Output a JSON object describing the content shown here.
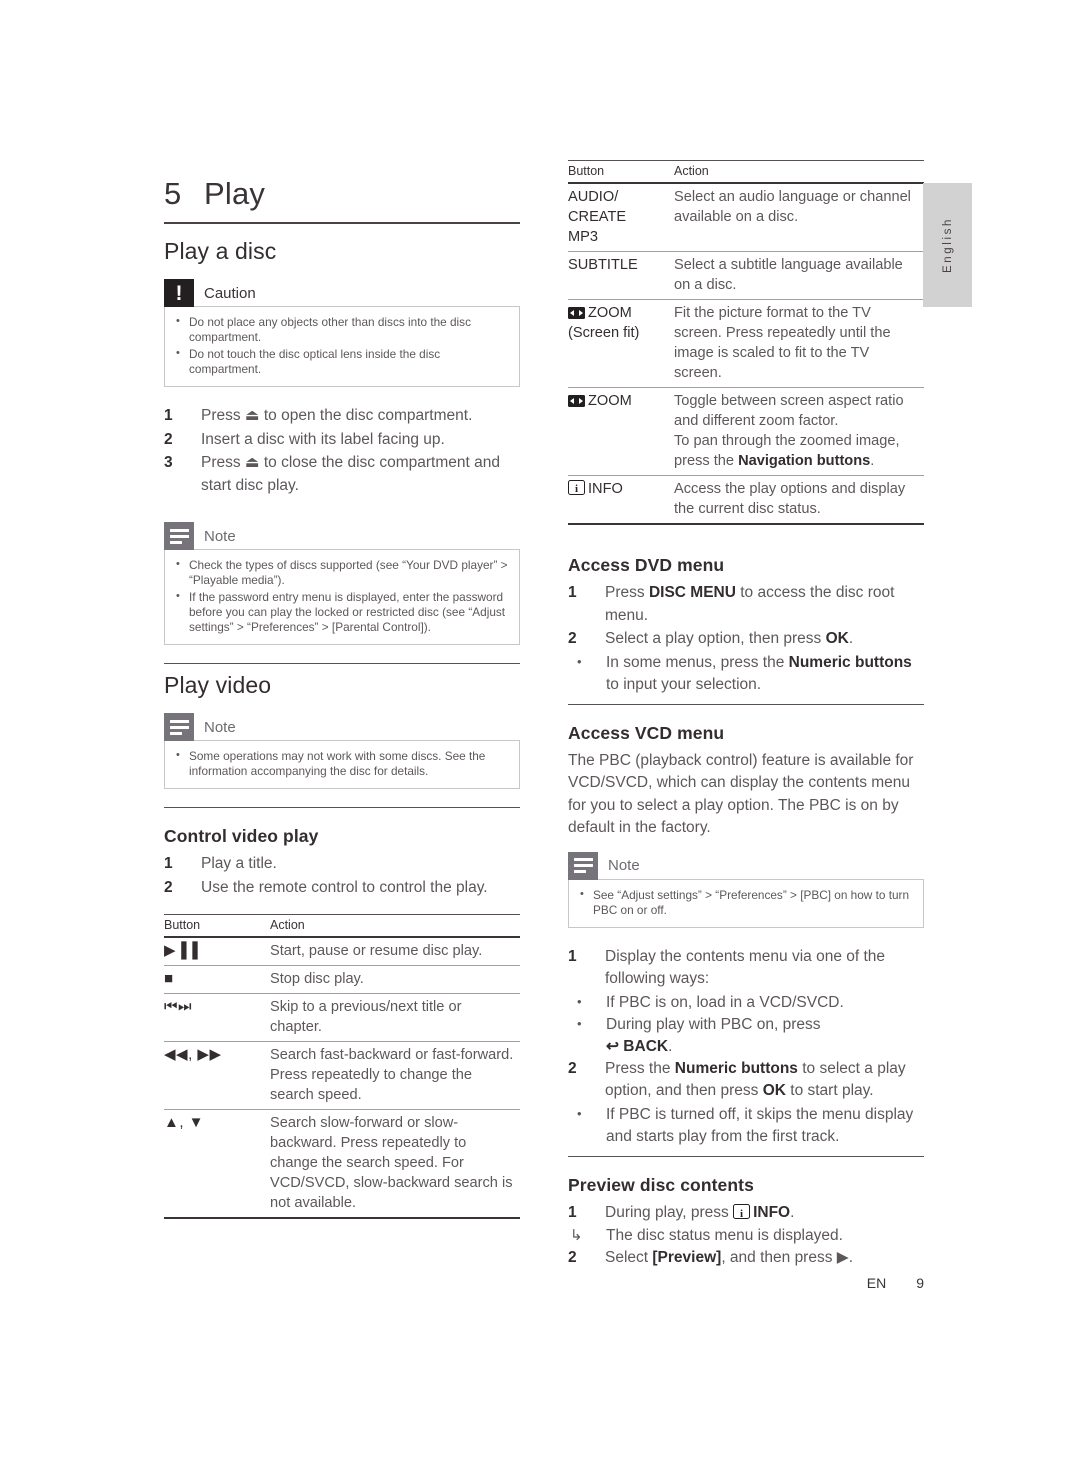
{
  "document": {
    "chapter_number": "5",
    "chapter_title": "Play",
    "language_tab": "English",
    "footer_locale": "EN",
    "footer_page": "9"
  },
  "left_column": {
    "section_play_a_disc": {
      "heading": "Play a disc",
      "caution": {
        "label": "Caution",
        "icon": "caution-icon",
        "items": [
          "Do not place any objects other than discs into the disc compartment.",
          "Do not touch the disc optical lens inside the disc compartment."
        ]
      },
      "steps": [
        {
          "num": "1",
          "text": "Press ⏏ to open the disc compartment."
        },
        {
          "num": "2",
          "text": "Insert a disc with its label facing up."
        },
        {
          "num": "3",
          "text": "Press ⏏ to close the disc compartment and start disc play."
        }
      ],
      "note": {
        "label": "Note",
        "icon": "note-icon",
        "items": [
          "Check the types of discs supported (see “Your DVD player” > “Playable media”).",
          "If the password entry menu is displayed, enter the password before you can play the locked or restricted disc (see “Adjust settings” > “Preferences” > [Parental Control])."
        ]
      }
    },
    "section_play_video": {
      "heading": "Play video",
      "note": {
        "label": "Note",
        "icon": "note-icon",
        "items": [
          "Some operations may not work with some discs. See the information accompanying the disc for details."
        ]
      },
      "subsection_control_video_play": {
        "heading": "Control video play",
        "steps": [
          {
            "num": "1",
            "text": "Play a title."
          },
          {
            "num": "2",
            "text": "Use the remote control to control the play."
          }
        ],
        "table": {
          "headers": [
            "Button",
            "Action"
          ],
          "rows": [
            {
              "button": "▶▐▐",
              "button_icon": "play-pause-icon",
              "action": "Start, pause or resume disc play."
            },
            {
              "button": "■",
              "button_icon": "stop-icon",
              "action": "Stop disc play."
            },
            {
              "button": "⏮⏭",
              "button_icon": "skip-previous-next-icon",
              "action": "Skip to a previous/next title or chapter."
            },
            {
              "button": "◀◀, ▶▶",
              "button_icon": "rewind-fastforward-icon",
              "action": "Search fast-backward or fast-forward. Press repeatedly to change the search speed."
            },
            {
              "button": "▲, ▼",
              "button_icon": "up-down-icon",
              "action": "Search slow-forward or slow-backward. Press repeatedly to change the search speed. For VCD/SVCD, slow-backward search is not available."
            }
          ]
        }
      }
    }
  },
  "right_column": {
    "table_continued": {
      "headers": [
        "Button",
        "Action"
      ],
      "rows": [
        {
          "button": "AUDIO/ CREATE MP3",
          "button_lines": [
            "AUDIO/",
            "CREATE",
            "MP3"
          ],
          "action": "Select an audio language or channel available on a disc."
        },
        {
          "button": "SUBTITLE",
          "button_lines": [
            "SUBTITLE"
          ],
          "action": "Select a subtitle language available on a disc."
        },
        {
          "button_icon": "zoom-icon",
          "button_lines": [
            "ZOOM",
            "(Screen fit)"
          ],
          "action": "Fit the picture format to the TV screen. Press repeatedly until the image is scaled to fit to the TV screen."
        },
        {
          "button_icon": "zoom-icon",
          "button_lines": [
            "ZOOM"
          ],
          "action": "Toggle between screen aspect ratio and different zoom factor. To pan through the zoomed image, press the Navigation buttons."
        },
        {
          "button_icon": "info-icon",
          "button_lines": [
            "INFO"
          ],
          "action": "Access the play options and display the current disc status."
        }
      ]
    },
    "section_access_dvd_menu": {
      "heading": "Access DVD menu",
      "steps": [
        {
          "num": "1",
          "text": "Press DISC MENU to access the disc root menu."
        },
        {
          "num": "2",
          "text": "Select a play option, then press OK."
        }
      ],
      "substeps": [
        "In some menus, press the Numeric buttons to input your selection."
      ]
    },
    "section_access_vcd_menu": {
      "heading": "Access VCD menu",
      "paragraph": "The PBC (playback control) feature is available for VCD/SVCD, which can display the contents menu for you to select a play option. The PBC is on by default in the factory.",
      "note": {
        "label": "Note",
        "icon": "note-icon",
        "items": [
          "See “Adjust settings” > “Preferences” > [PBC] on how to turn PBC on or off."
        ]
      },
      "steps": [
        {
          "num": "1",
          "text": "Display the contents menu via one of the following ways:"
        },
        {
          "num": "2",
          "text": "Press the Numeric buttons to select a play option, and then press OK to start play."
        }
      ],
      "substeps_1": [
        "If PBC is on, load in a VCD/SVCD.",
        "During play with PBC on, press ↶ BACK."
      ],
      "substeps_2": [
        "If PBC is turned off, it skips the menu display and starts play from the first track."
      ]
    },
    "section_preview_disc_contents": {
      "heading": "Preview disc contents",
      "steps": [
        {
          "num": "1",
          "text": "During play, press ⓘ INFO."
        },
        {
          "num": "2",
          "text": "Select [Preview], and then press ▶."
        }
      ],
      "result_line": "The disc status menu is displayed."
    }
  }
}
